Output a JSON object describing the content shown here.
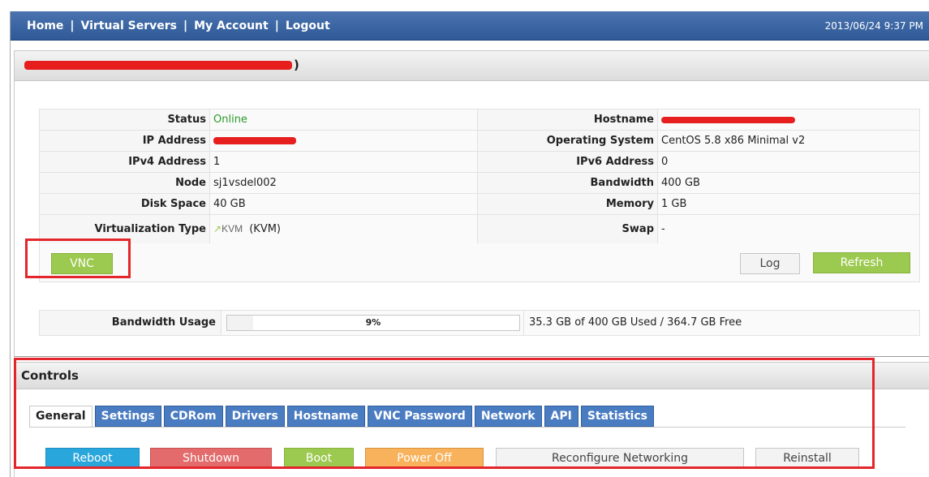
{
  "topbar": {
    "nav": [
      {
        "label": "Home"
      },
      {
        "label": "Virtual Servers"
      },
      {
        "label": "My Account"
      },
      {
        "label": "Logout"
      }
    ],
    "separator": "|",
    "datetime": "2013/06/24 9:37 PM"
  },
  "server": {
    "title_suffix": ")"
  },
  "info": {
    "status_label": "Status",
    "status_value": "Online",
    "hostname_label": "Hostname",
    "ip_label": "IP Address",
    "os_label": "Operating System",
    "os_value": "CentOS 5.8 x86 Minimal v2",
    "ipv4_label": "IPv4 Address",
    "ipv4_value": "1",
    "ipv6_label": "IPv6 Address",
    "ipv6_value": "0",
    "node_label": "Node",
    "node_value": "sj1vsdel002",
    "bandwidth_label": "Bandwidth",
    "bandwidth_value": "400 GB",
    "disk_label": "Disk Space",
    "disk_value": "40 GB",
    "memory_label": "Memory",
    "memory_value": "1 GB",
    "virt_label": "Virtualization Type",
    "virt_logo": "KVM",
    "virt_value": "(KVM)",
    "swap_label": "Swap",
    "swap_value": "-"
  },
  "buttons": {
    "vnc": "VNC",
    "log": "Log",
    "refresh": "Refresh"
  },
  "bandwidth_usage": {
    "label": "Bandwidth Usage",
    "percent_text": "9%",
    "percent": 9,
    "summary": "35.3 GB of 400 GB Used / 364.7 GB Free"
  },
  "controls": {
    "title": "Controls",
    "tabs": [
      "General",
      "Settings",
      "CDRom",
      "Drivers",
      "Hostname",
      "VNC Password",
      "Network",
      "API",
      "Statistics"
    ],
    "actions": {
      "reboot": "Reboot",
      "shutdown": "Shutdown",
      "boot": "Boot",
      "poweroff": "Power Off",
      "reconfigure": "Reconfigure Networking",
      "reinstall": "Reinstall"
    }
  },
  "colors": {
    "nav_bg": "#3a65a3",
    "online": "#2a9a2a",
    "highlight": "#e3262b",
    "redaction": "#e61e1e"
  }
}
